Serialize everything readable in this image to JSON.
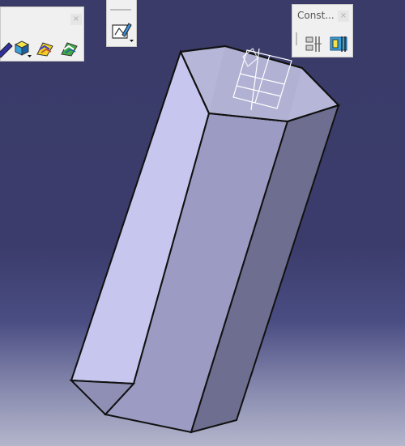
{
  "toolbars": {
    "view_toolbar": {
      "close_glyph": "×",
      "icons": [
        "shading-icon",
        "view-mode-icon",
        "render-style-icon",
        "material-icon"
      ]
    },
    "sketch_toolbar": {
      "icons": [
        "sketch-icon"
      ]
    },
    "constraint_toolbar": {
      "title": "Const...",
      "close_glyph": "×",
      "icons": [
        "constraint-icon",
        "constraint-defined-icon"
      ]
    }
  },
  "viewport": {
    "object": "hexagonal-prism",
    "colors": {
      "background_top": "#3a3b68",
      "background_bottom": "#b4b6cc",
      "face_light": "#c9c9f0",
      "face_mid": "#9a9ac2",
      "face_dark": "#6d6d8f",
      "top_face": "#b8b8d9",
      "edge": "#111111"
    }
  }
}
